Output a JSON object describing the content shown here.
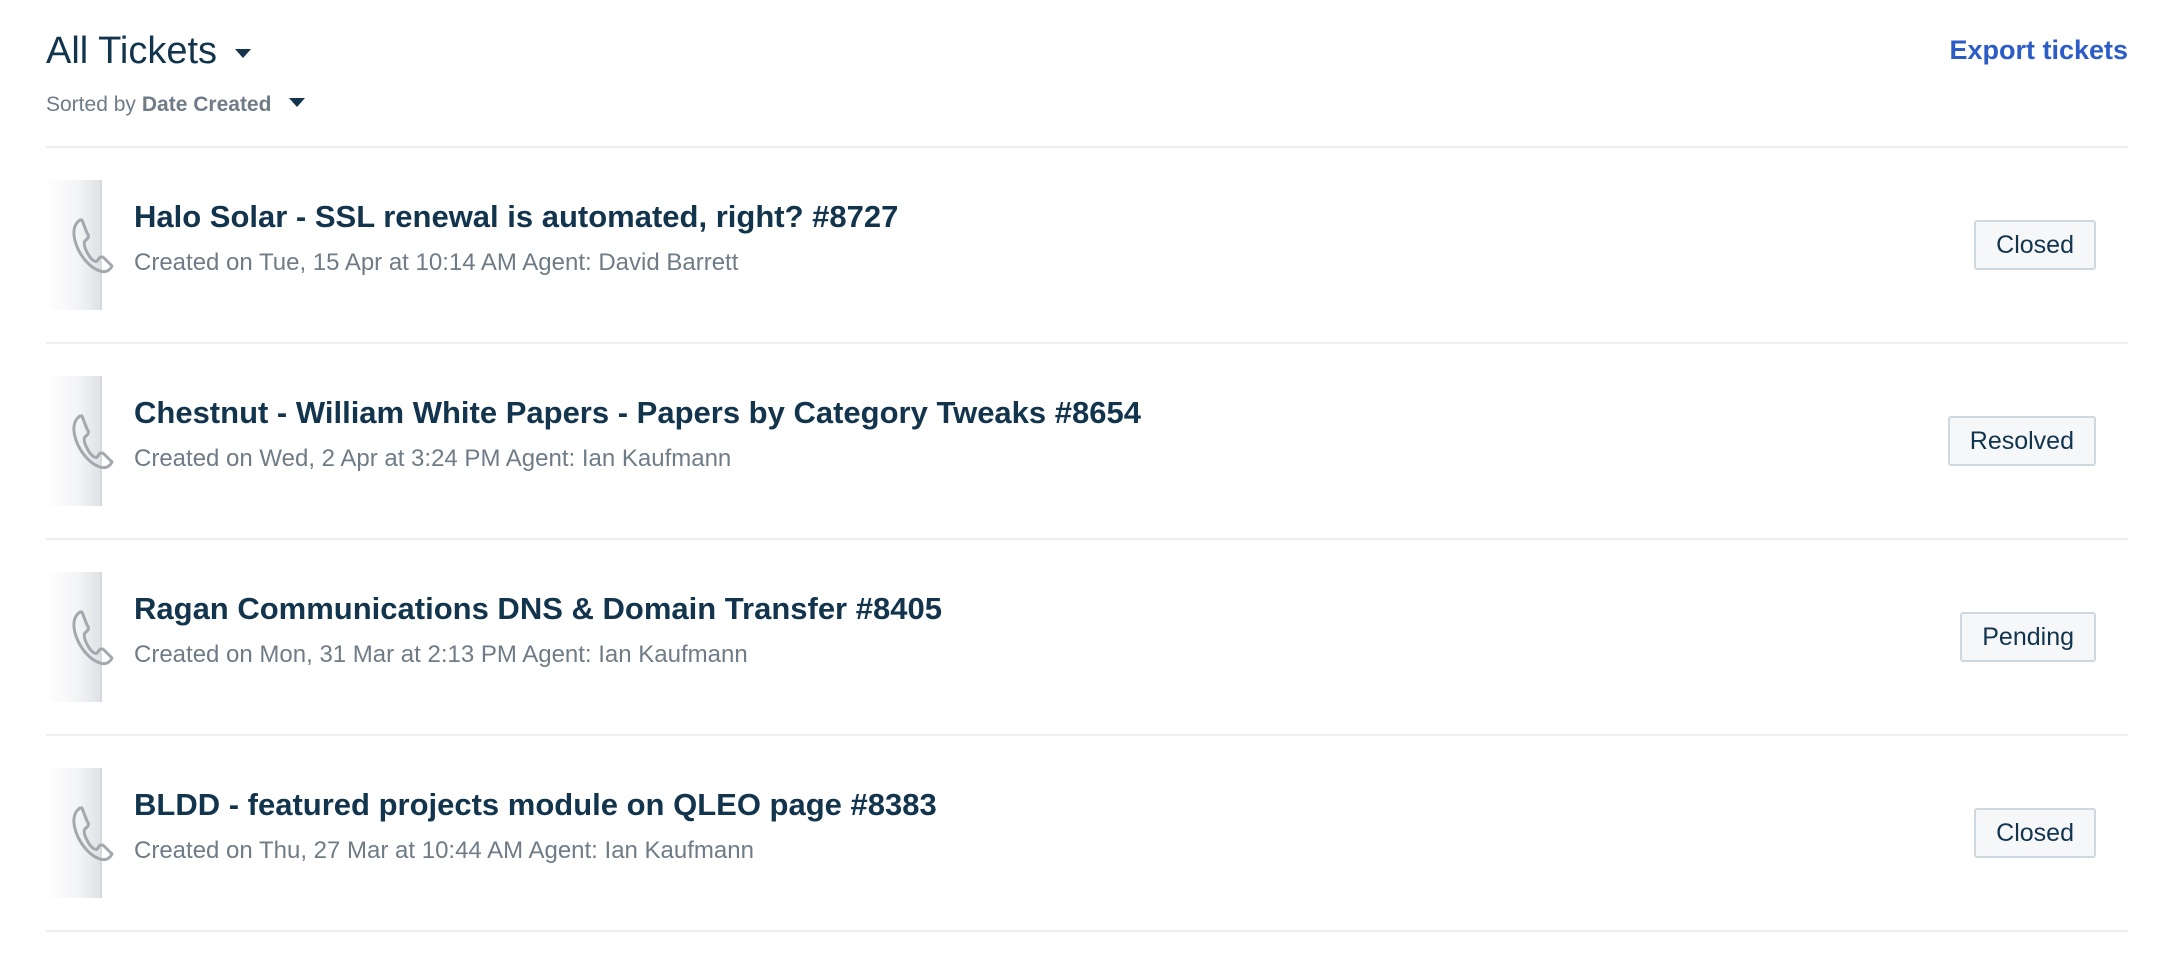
{
  "header": {
    "view_title": "All Tickets",
    "sorted_by_label": "Sorted by",
    "sorted_by_value": "Date Created",
    "export_label": "Export tickets"
  },
  "colors": {
    "accent_link": "#2c5cc5",
    "title_text": "#12344d",
    "meta_text": "#6f7c87",
    "divider": "#ebeff3"
  },
  "tickets": [
    {
      "title": "Halo Solar - SSL renewal is automated, right? #8727",
      "meta": "Created on Tue, 15 Apr at 10:14 AM Agent: David Barrett",
      "status": "Closed",
      "channel_icon": "phone-icon"
    },
    {
      "title": "Chestnut - William White Papers - Papers by Category Tweaks #8654",
      "meta": "Created on Wed, 2 Apr at 3:24 PM Agent: Ian Kaufmann",
      "status": "Resolved",
      "channel_icon": "phone-icon"
    },
    {
      "title": "Ragan Communications DNS & Domain Transfer #8405",
      "meta": "Created on Mon, 31 Mar at 2:13 PM Agent: Ian Kaufmann",
      "status": "Pending",
      "channel_icon": "phone-icon"
    },
    {
      "title": "BLDD - featured projects module on QLEO page #8383",
      "meta": "Created on Thu, 27 Mar at 10:44 AM Agent: Ian Kaufmann",
      "status": "Closed",
      "channel_icon": "phone-icon"
    }
  ]
}
